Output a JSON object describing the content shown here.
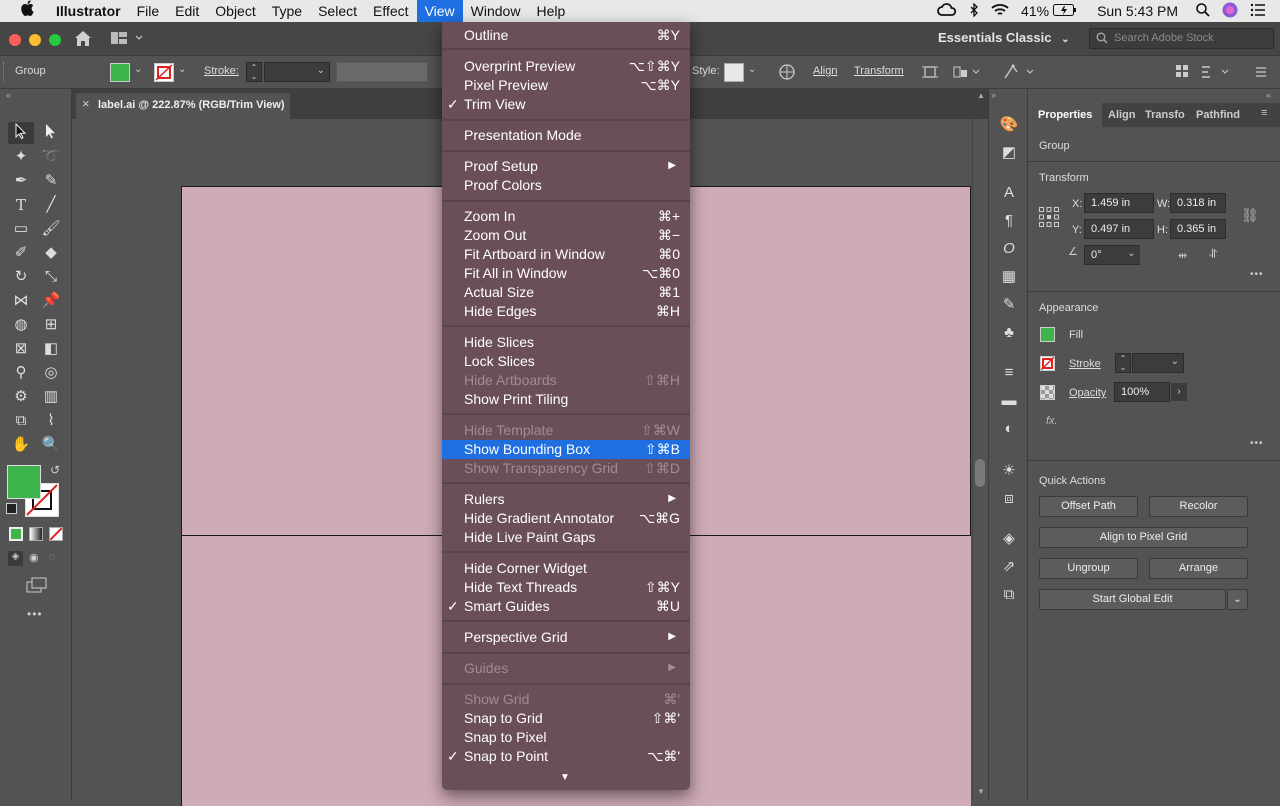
{
  "menubar": {
    "apple": "",
    "app_name": "Illustrator",
    "menus": [
      "File",
      "Edit",
      "Object",
      "Type",
      "Select",
      "Effect",
      "View",
      "Window",
      "Help"
    ],
    "battery": "41%",
    "clock": "Sun 5:43 PM"
  },
  "appbar": {
    "workspace": "Essentials Classic",
    "search_placeholder": "Search Adobe Stock"
  },
  "controlbar": {
    "selection_label": "Group",
    "stroke_label": "Stroke:",
    "style_label": "Style:",
    "align_link": "Align",
    "transform_link": "Transform"
  },
  "document": {
    "tab_title": "label.ai @ 222.87% (RGB/Trim View)",
    "close": "×"
  },
  "view_menu": {
    "items": [
      {
        "label": "Outline",
        "shortcut": "⌘Y"
      },
      {
        "label": "Overprint Preview",
        "shortcut": "⌥⇧⌘Y"
      },
      {
        "label": "Pixel Preview",
        "shortcut": "⌥⌘Y"
      },
      {
        "label": "Trim View",
        "shortcut": "",
        "check": "✓"
      },
      {
        "label": "Presentation Mode",
        "shortcut": ""
      },
      {
        "label": "Proof Setup",
        "shortcut": "▶"
      },
      {
        "label": "Proof Colors",
        "shortcut": ""
      },
      {
        "label": "Zoom In",
        "shortcut": "⌘+"
      },
      {
        "label": "Zoom Out",
        "shortcut": "⌘−"
      },
      {
        "label": "Fit Artboard in Window",
        "shortcut": "⌘0"
      },
      {
        "label": "Fit All in Window",
        "shortcut": "⌥⌘0"
      },
      {
        "label": "Actual Size",
        "shortcut": "⌘1"
      },
      {
        "label": "Hide Edges",
        "shortcut": "⌘H"
      },
      {
        "label": "Hide Slices",
        "shortcut": ""
      },
      {
        "label": "Lock Slices",
        "shortcut": ""
      },
      {
        "label": "Hide Artboards",
        "shortcut": "⇧⌘H",
        "disabled": true
      },
      {
        "label": "Show Print Tiling",
        "shortcut": ""
      },
      {
        "label": "Hide Template",
        "shortcut": "⇧⌘W",
        "disabled": true
      },
      {
        "label": "Show Bounding Box",
        "shortcut": "⇧⌘B",
        "highlight": true
      },
      {
        "label": "Show Transparency Grid",
        "shortcut": "⇧⌘D",
        "disabled": true
      },
      {
        "label": "Rulers",
        "shortcut": "▶"
      },
      {
        "label": "Hide Gradient Annotator",
        "shortcut": "⌥⌘G"
      },
      {
        "label": "Hide Live Paint Gaps",
        "shortcut": ""
      },
      {
        "label": "Hide Corner Widget",
        "shortcut": ""
      },
      {
        "label": "Hide Text Threads",
        "shortcut": "⇧⌘Y"
      },
      {
        "label": "Smart Guides",
        "shortcut": "⌘U",
        "check": "✓"
      },
      {
        "label": "Perspective Grid",
        "shortcut": "▶"
      },
      {
        "label": "Guides",
        "shortcut": "▶",
        "disabled": true
      },
      {
        "label": "Show Grid",
        "shortcut": "⌘'",
        "disabled": true
      },
      {
        "label": "Snap to Grid",
        "shortcut": "⇧⌘'"
      },
      {
        "label": "Snap to Pixel",
        "shortcut": ""
      },
      {
        "label": "Snap to Point",
        "shortcut": "⌥⌘'",
        "check": "✓"
      }
    ],
    "more_arrow": "▼"
  },
  "panel": {
    "tabs": [
      "Properties",
      "Align",
      "Transfo",
      "Pathfind"
    ],
    "selection_type": "Group",
    "transform_title": "Transform",
    "x_label": "X:",
    "x_value": "1.459 in",
    "y_label": "Y:",
    "y_value": "0.497 in",
    "w_label": "W:",
    "w_value": "0.318 in",
    "h_label": "H:",
    "h_value": "0.365 in",
    "angle_value": "0°",
    "appearance_title": "Appearance",
    "fill_label": "Fill",
    "stroke_label": "Stroke",
    "opacity_label": "Opacity",
    "opacity_value": "100%",
    "fx_label": "fx.",
    "quick_actions_title": "Quick Actions",
    "offset_path": "Offset Path",
    "recolor": "Recolor",
    "align_pixel_grid": "Align to Pixel Grid",
    "ungroup": "Ungroup",
    "arrange": "Arrange",
    "start_global_edit": "Start Global Edit",
    "more": "•••"
  },
  "colors": {
    "fill": "#3db54a",
    "artboard": "#cfabb6",
    "menu_bg": "#6a4f5a",
    "highlight": "#1f6fe0"
  }
}
